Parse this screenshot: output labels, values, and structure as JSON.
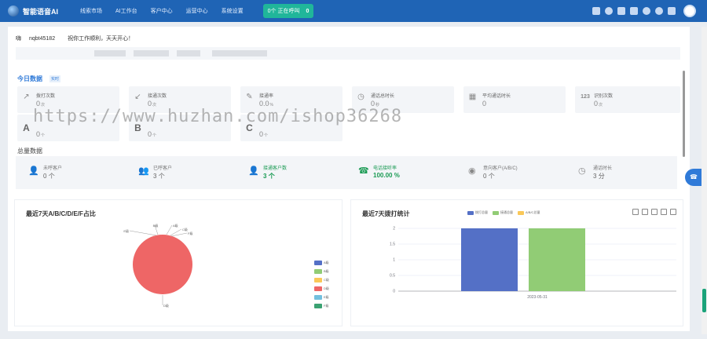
{
  "app": {
    "title": "智能语音AI"
  },
  "nav": [
    "线索市场",
    "AI工作台",
    "客户中心",
    "运营中心",
    "系统设置"
  ],
  "call_status": {
    "label": "0个 正在呼叫",
    "count": "0"
  },
  "greeting": {
    "prefix": "嗨",
    "user": "nqbt45182",
    "message": "祝你工作顺利，天天开心！"
  },
  "today": {
    "title": "今日数据",
    "tag": "实时",
    "cards": [
      {
        "label": "拨打次数",
        "value": "0",
        "unit": "次",
        "icon": "arrow-up-right-icon"
      },
      {
        "label": "接通次数",
        "value": "0",
        "unit": "次",
        "icon": "arrow-down-left-icon"
      },
      {
        "label": "接通率",
        "value": "0.0",
        "unit": "%",
        "icon": "feather-icon"
      },
      {
        "label": "通话总时长",
        "value": "0",
        "unit": "秒",
        "icon": "timer-icon"
      },
      {
        "label": "平均通话时长",
        "value": "0",
        "unit": "",
        "icon": "calendar-icon"
      },
      {
        "label": "识别次数",
        "value": "0",
        "unit": "次",
        "icon": "number-icon"
      }
    ],
    "grades": [
      {
        "letter": "A",
        "value": "0",
        "unit": "个"
      },
      {
        "letter": "B",
        "value": "0",
        "unit": "个"
      },
      {
        "letter": "C",
        "value": "0",
        "unit": "个"
      }
    ]
  },
  "total": {
    "title": "总量数据",
    "items": [
      {
        "label": "未呼客户",
        "value": "0",
        "unit": "个",
        "icon": "user-icon"
      },
      {
        "label": "已呼客户",
        "value": "3",
        "unit": "个",
        "icon": "users-icon"
      },
      {
        "label": "接通客户数",
        "value": "3",
        "unit": "个",
        "icon": "user-check-icon"
      },
      {
        "label": "电话接听率",
        "value": "100.00",
        "unit": "%",
        "icon": "phone-icon"
      },
      {
        "label": "意向客户(A/B/C)",
        "value": "0",
        "unit": "个",
        "icon": "user-circle-icon"
      },
      {
        "label": "通话时长",
        "value": "3",
        "unit": "分",
        "icon": "clock-icon"
      }
    ]
  },
  "pie_chart": {
    "title": "最近7天A/B/C/D/E/F占比",
    "legend": [
      {
        "name": "A级",
        "color": "#5470c6"
      },
      {
        "name": "B级",
        "color": "#91cc75"
      },
      {
        "name": "C级",
        "color": "#fac858"
      },
      {
        "name": "D级",
        "color": "#ee6666"
      },
      {
        "name": "E级",
        "color": "#73c0de"
      },
      {
        "name": "F级",
        "color": "#3ba272"
      }
    ]
  },
  "bar_chart": {
    "title": "最近7天拨打统计",
    "legend": [
      {
        "name": "拨打总量",
        "color": "#5470c6"
      },
      {
        "name": "接通总量",
        "color": "#91cc75"
      },
      {
        "name": "A/B/C总量",
        "color": "#fac858"
      }
    ]
  },
  "chart_data": [
    {
      "type": "pie",
      "title": "最近7天A/B/C/D/E/F占比",
      "categories": [
        "A级",
        "B级",
        "C级",
        "D级",
        "E级",
        "F级"
      ],
      "values": [
        0,
        0,
        0,
        3,
        0,
        0
      ]
    },
    {
      "type": "bar",
      "title": "最近7天拨打统计",
      "categories": [
        "2023-05-31"
      ],
      "series": [
        {
          "name": "拨打总量",
          "values": [
            2
          ]
        },
        {
          "name": "接通总量",
          "values": [
            2
          ]
        },
        {
          "name": "A/B/C总量",
          "values": [
            0
          ]
        }
      ],
      "ylim": [
        0,
        2
      ],
      "yticks": [
        "0",
        "0.5",
        "1",
        "1.5",
        "2"
      ]
    }
  ],
  "watermark": "https://www.huzhan.com/ishop36268"
}
